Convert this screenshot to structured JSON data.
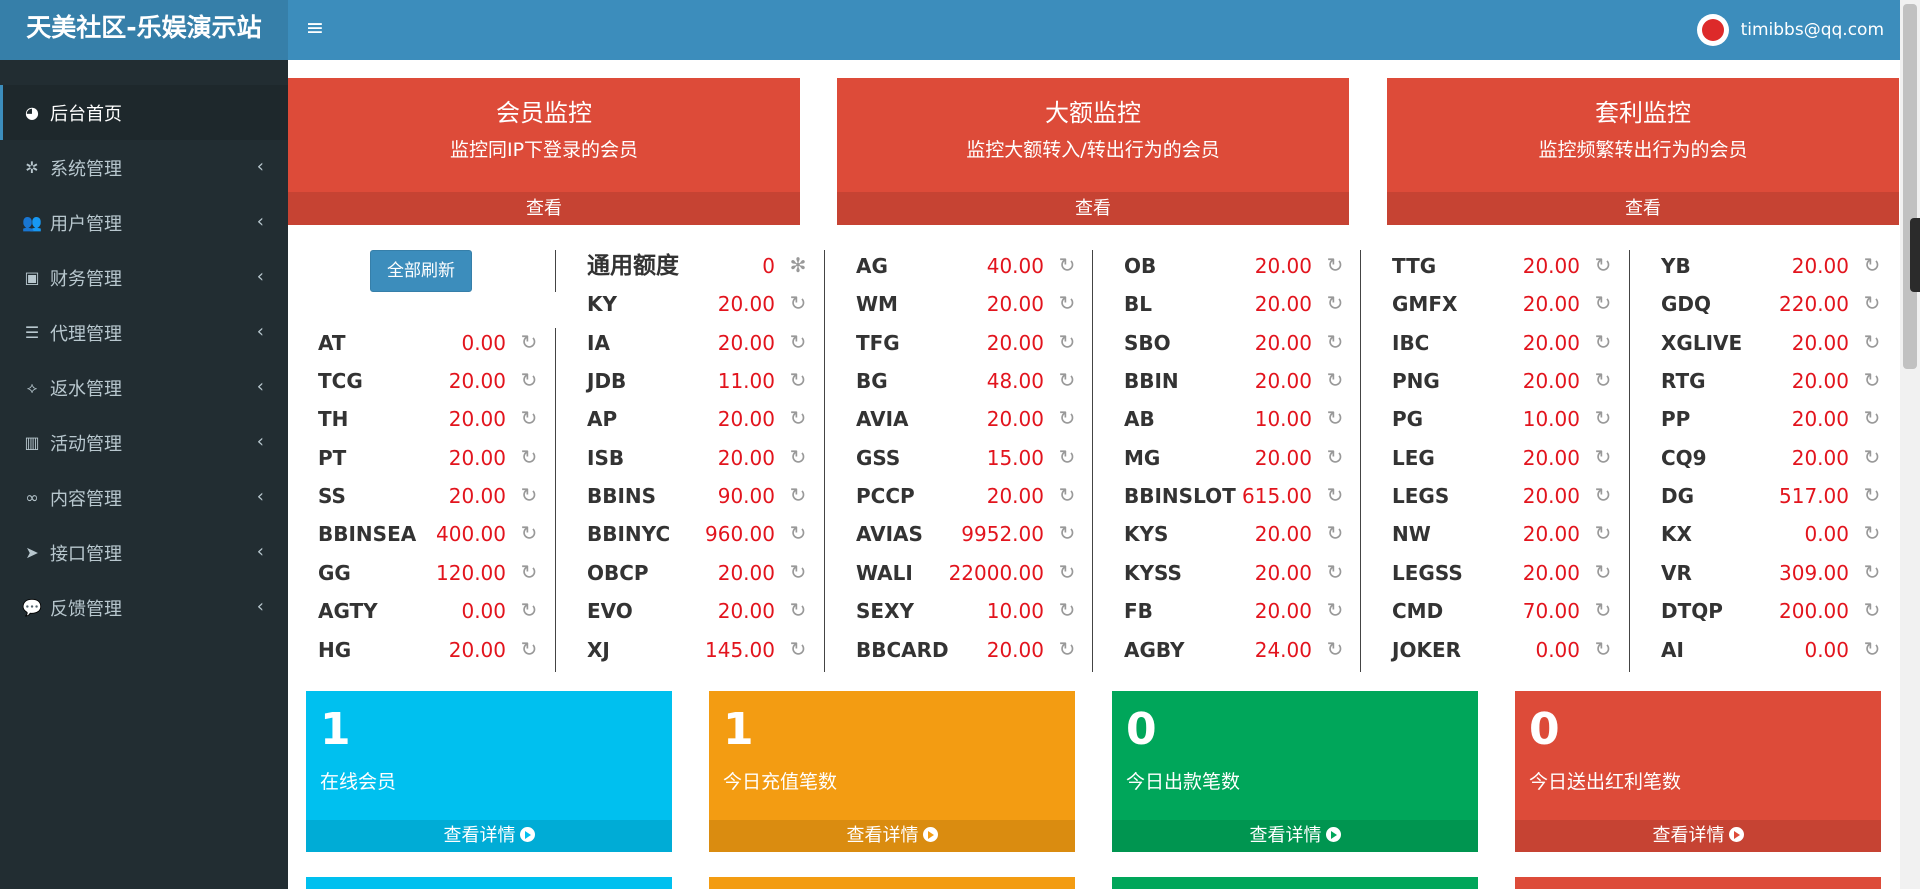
{
  "header": {
    "logo": "天美社区-乐娱演示站",
    "user_email": "timibbs@qq.com"
  },
  "sidebar": {
    "items": [
      {
        "label": "后台首页",
        "icon": "dashboard-icon",
        "glyph": "◕",
        "active": true
      },
      {
        "label": "系统管理",
        "icon": "gear-icon",
        "glyph": "✲"
      },
      {
        "label": "用户管理",
        "icon": "users-icon",
        "glyph": "👥"
      },
      {
        "label": "财务管理",
        "icon": "money-icon",
        "glyph": "▣"
      },
      {
        "label": "代理管理",
        "icon": "list-icon",
        "glyph": "☰"
      },
      {
        "label": "返水管理",
        "icon": "code-icon",
        "glyph": "⟡"
      },
      {
        "label": "活动管理",
        "icon": "map-icon",
        "glyph": "▥"
      },
      {
        "label": "内容管理",
        "icon": "link-icon",
        "glyph": "∞"
      },
      {
        "label": "接口管理",
        "icon": "paper-plane-icon",
        "glyph": "➤"
      },
      {
        "label": "反馈管理",
        "icon": "comments-icon",
        "glyph": "💬"
      }
    ]
  },
  "monitors": [
    {
      "title": "会员监控",
      "subtitle": "监控同IP下登录的会员",
      "link": "查看"
    },
    {
      "title": "大额监控",
      "subtitle": "监控大额转入/转出行为的会员",
      "link": "查看"
    },
    {
      "title": "套利监控",
      "subtitle": "监控频繁转出行为的会员",
      "link": "查看"
    }
  ],
  "refresh_all_label": "全部刷新",
  "general_balance": {
    "name": "通用额度",
    "value": "0"
  },
  "balance_columns": [
    [
      {
        "name": "AT",
        "value": "0.00"
      },
      {
        "name": "TCG",
        "value": "20.00"
      },
      {
        "name": "TH",
        "value": "20.00"
      },
      {
        "name": "PT",
        "value": "20.00"
      },
      {
        "name": "SS",
        "value": "20.00"
      },
      {
        "name": "BBINSEA",
        "value": "400.00"
      },
      {
        "name": "GG",
        "value": "120.00"
      },
      {
        "name": "AGTY",
        "value": "0.00"
      },
      {
        "name": "HG",
        "value": "20.00"
      }
    ],
    [
      {
        "name": "KY",
        "value": "20.00"
      },
      {
        "name": "IA",
        "value": "20.00"
      },
      {
        "name": "JDB",
        "value": "11.00"
      },
      {
        "name": "AP",
        "value": "20.00"
      },
      {
        "name": "ISB",
        "value": "20.00"
      },
      {
        "name": "BBINS",
        "value": "90.00"
      },
      {
        "name": "BBINYC",
        "value": "960.00"
      },
      {
        "name": "OBCP",
        "value": "20.00"
      },
      {
        "name": "EVO",
        "value": "20.00"
      },
      {
        "name": "XJ",
        "value": "145.00"
      }
    ],
    [
      {
        "name": "AG",
        "value": "40.00"
      },
      {
        "name": "WM",
        "value": "20.00"
      },
      {
        "name": "TFG",
        "value": "20.00"
      },
      {
        "name": "BG",
        "value": "48.00"
      },
      {
        "name": "AVIA",
        "value": "20.00"
      },
      {
        "name": "GSS",
        "value": "15.00"
      },
      {
        "name": "PCCP",
        "value": "20.00"
      },
      {
        "name": "AVIAS",
        "value": "9952.00"
      },
      {
        "name": "WALI",
        "value": "22000.00"
      },
      {
        "name": "SEXY",
        "value": "10.00"
      },
      {
        "name": "BBCARD",
        "value": "20.00"
      }
    ],
    [
      {
        "name": "OB",
        "value": "20.00"
      },
      {
        "name": "BL",
        "value": "20.00"
      },
      {
        "name": "SBO",
        "value": "20.00"
      },
      {
        "name": "BBIN",
        "value": "20.00"
      },
      {
        "name": "AB",
        "value": "10.00"
      },
      {
        "name": "MG",
        "value": "20.00"
      },
      {
        "name": "BBINSLOT",
        "value": "615.00"
      },
      {
        "name": "KYS",
        "value": "20.00"
      },
      {
        "name": "KYSS",
        "value": "20.00"
      },
      {
        "name": "FB",
        "value": "20.00"
      },
      {
        "name": "AGBY",
        "value": "24.00"
      }
    ],
    [
      {
        "name": "TTG",
        "value": "20.00"
      },
      {
        "name": "GMFX",
        "value": "20.00"
      },
      {
        "name": "IBC",
        "value": "20.00"
      },
      {
        "name": "PNG",
        "value": "20.00"
      },
      {
        "name": "PG",
        "value": "10.00"
      },
      {
        "name": "LEG",
        "value": "20.00"
      },
      {
        "name": "LEGS",
        "value": "20.00"
      },
      {
        "name": "NW",
        "value": "20.00"
      },
      {
        "name": "LEGSS",
        "value": "20.00"
      },
      {
        "name": "CMD",
        "value": "70.00"
      },
      {
        "name": "JOKER",
        "value": "0.00"
      }
    ],
    [
      {
        "name": "YB",
        "value": "20.00"
      },
      {
        "name": "GDQ",
        "value": "220.00"
      },
      {
        "name": "XGLIVE",
        "value": "20.00"
      },
      {
        "name": "RTG",
        "value": "20.00"
      },
      {
        "name": "PP",
        "value": "20.00"
      },
      {
        "name": "CQ9",
        "value": "20.00"
      },
      {
        "name": "DG",
        "value": "517.00"
      },
      {
        "name": "KX",
        "value": "0.00"
      },
      {
        "name": "VR",
        "value": "309.00"
      },
      {
        "name": "DTQP",
        "value": "200.00"
      },
      {
        "name": "AI",
        "value": "0.00"
      }
    ]
  ],
  "stats": [
    {
      "value": "1",
      "label": "在线会员",
      "link": "查看详情",
      "color": "#00c0ef"
    },
    {
      "value": "1",
      "label": "今日充值笔数",
      "link": "查看详情",
      "color": "#f39c12"
    },
    {
      "value": "0",
      "label": "今日出款笔数",
      "link": "查看详情",
      "color": "#00a65a"
    },
    {
      "value": "0",
      "label": "今日送出红利笔数",
      "link": "查看详情",
      "color": "#dd4b39"
    }
  ]
}
